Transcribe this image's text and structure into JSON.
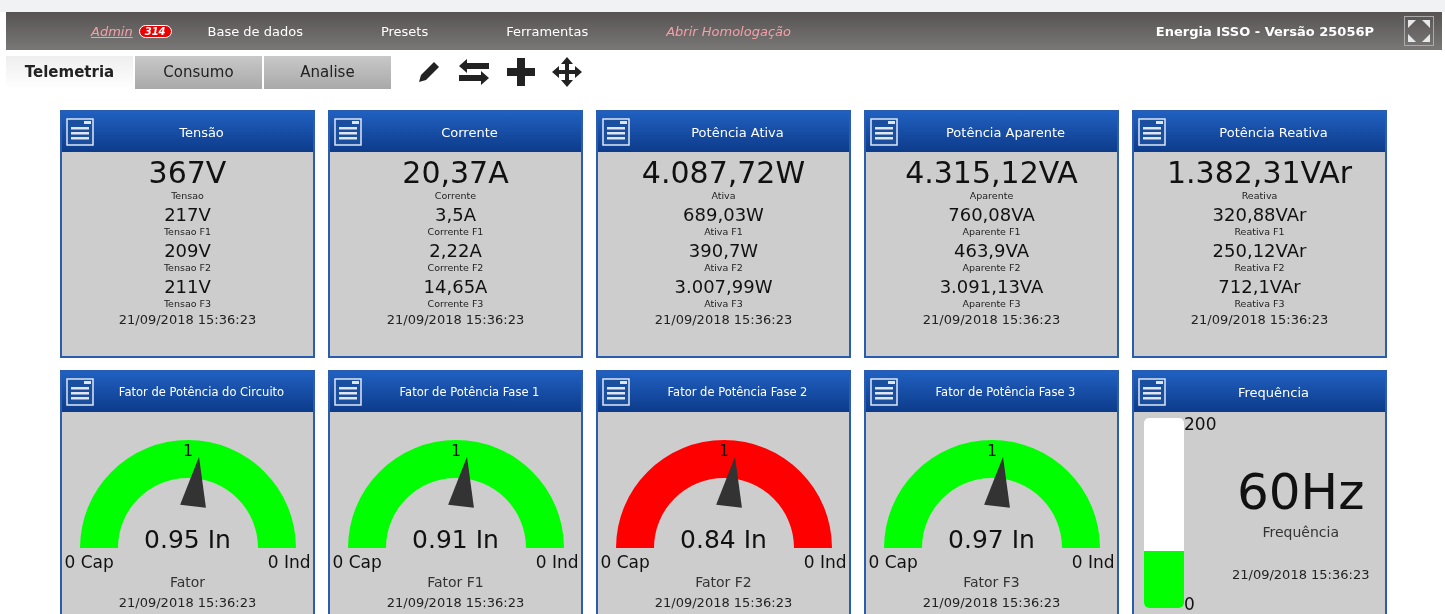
{
  "navbar": {
    "items": [
      {
        "kind": "link",
        "label": "Admin",
        "badge": "314"
      },
      {
        "kind": "menu",
        "label": "Base de dados"
      },
      {
        "kind": "menu",
        "label": "Presets"
      },
      {
        "kind": "menu",
        "label": "Ferramentas"
      },
      {
        "kind": "link",
        "label": "Abrir Homologação"
      }
    ],
    "title": "Energia ISSO - Versão 25056P"
  },
  "tabs": [
    {
      "label": "Telemetria",
      "selected": true
    },
    {
      "label": "Consumo",
      "selected": false
    },
    {
      "label": "Analise",
      "selected": false
    }
  ],
  "metric_cards": [
    {
      "title": "Tensão",
      "main": {
        "value": "367V",
        "label": "Tensao"
      },
      "phases": [
        {
          "value": "217V",
          "label": "Tensao F1"
        },
        {
          "value": "209V",
          "label": "Tensao F2"
        },
        {
          "value": "211V",
          "label": "Tensao F3"
        }
      ],
      "timestamp": "21/09/2018 15:36:23"
    },
    {
      "title": "Corrente",
      "main": {
        "value": "20,37A",
        "label": "Corrente"
      },
      "phases": [
        {
          "value": "3,5A",
          "label": "Corrente F1"
        },
        {
          "value": "2,22A",
          "label": "Corrente F2"
        },
        {
          "value": "14,65A",
          "label": "Corrente F3"
        }
      ],
      "timestamp": "21/09/2018 15:36:23"
    },
    {
      "title": "Potência Ativa",
      "main": {
        "value": "4.087,72W",
        "label": "Ativa"
      },
      "phases": [
        {
          "value": "689,03W",
          "label": "Ativa F1"
        },
        {
          "value": "390,7W",
          "label": "Ativa F2"
        },
        {
          "value": "3.007,99W",
          "label": "Ativa F3"
        }
      ],
      "timestamp": "21/09/2018 15:36:23"
    },
    {
      "title": "Potência Aparente",
      "main": {
        "value": "4.315,12VA",
        "label": "Aparente"
      },
      "phases": [
        {
          "value": "760,08VA",
          "label": "Aparente F1"
        },
        {
          "value": "463,9VA",
          "label": "Aparente F2"
        },
        {
          "value": "3.091,13VA",
          "label": "Aparente F3"
        }
      ],
      "timestamp": "21/09/2018 15:36:23"
    },
    {
      "title": "Potência Reativa",
      "main": {
        "value": "1.382,31VAr",
        "label": "Reativa"
      },
      "phases": [
        {
          "value": "320,88VAr",
          "label": "Reativa F1"
        },
        {
          "value": "250,12VAr",
          "label": "Reativa F2"
        },
        {
          "value": "712,1VAr",
          "label": "Reativa F3"
        }
      ],
      "timestamp": "21/09/2018 15:36:23"
    }
  ],
  "gauge_cards": [
    {
      "title": "Fator de Potência do Circuito",
      "peak_label": "1",
      "value": "0.95 In",
      "min_label": "0 Cap",
      "max_label": "0 Ind",
      "caption": "Fator",
      "timestamp": "21/09/2018 15:36:23",
      "color": "#00ff00"
    },
    {
      "title": "Fator de Potência Fase 1",
      "peak_label": "1",
      "value": "0.91 In",
      "min_label": "0 Cap",
      "max_label": "0 Ind",
      "caption": "Fator F1",
      "timestamp": "21/09/2018 15:36:23",
      "color": "#00ff00"
    },
    {
      "title": "Fator de Potência Fase 2",
      "peak_label": "1",
      "value": "0.84 In",
      "min_label": "0 Cap",
      "max_label": "0 Ind",
      "caption": "Fator F2",
      "timestamp": "21/09/2018 15:36:23",
      "color": "#ff0000"
    },
    {
      "title": "Fator de Potência Fase 3",
      "peak_label": "1",
      "value": "0.97 In",
      "min_label": "0 Cap",
      "max_label": "0 Ind",
      "caption": "Fator F3",
      "timestamp": "21/09/2018 15:36:23",
      "color": "#00ff00"
    }
  ],
  "frequency_card": {
    "title": "Frequência",
    "max_label": "200",
    "min_label": "0",
    "value": "60Hz",
    "caption": "Frequência",
    "timestamp": "21/09/2018 15:36:23",
    "level": 0.3
  }
}
